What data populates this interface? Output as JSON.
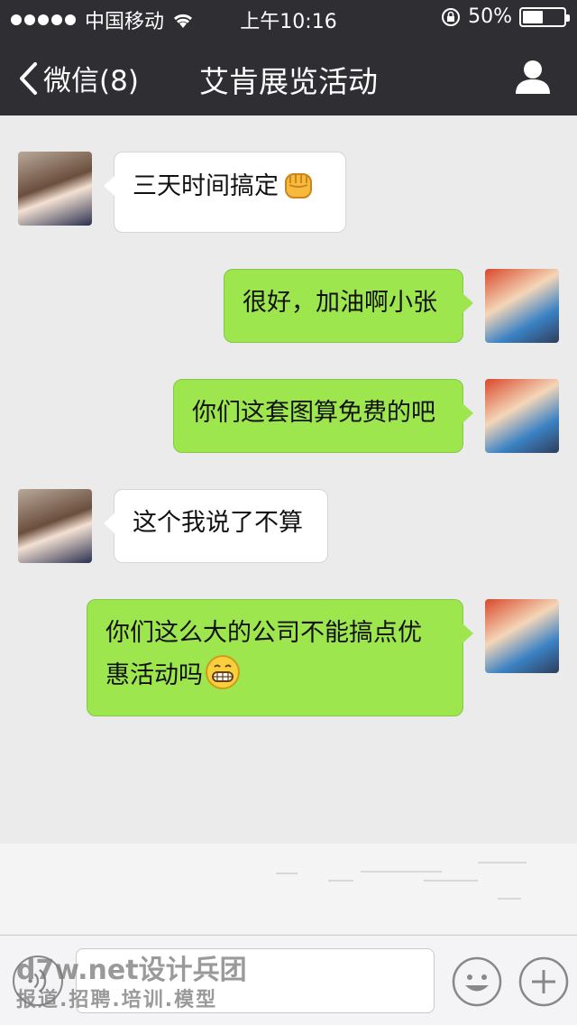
{
  "status_bar": {
    "carrier": "中国移动",
    "time": "上午10:16",
    "battery_text": "50%",
    "battery_level": 0.5
  },
  "nav": {
    "back_label": "微信(8)",
    "title": "艾肯展览活动",
    "user_icon": "user-icon"
  },
  "messages": [
    {
      "side": "in",
      "text": "三天时间搞定",
      "emoji": "fist-emoji"
    },
    {
      "side": "out",
      "text": "很好，加油啊小张"
    },
    {
      "side": "out",
      "text": "你们这套图算免费的吧"
    },
    {
      "side": "in",
      "text": "这个我说了不算"
    },
    {
      "side": "out",
      "text": "你们这么大的公司不能搞点优惠活动吗",
      "emoji": "grin-emoji"
    }
  ],
  "input_bar": {
    "voice_icon": "voice-icon",
    "emoji_icon": "smile-icon",
    "plus_icon": "plus-icon"
  },
  "watermark": {
    "line1": "d7w.net设计兵团",
    "line2": "报道.招聘.培训.模型"
  },
  "colors": {
    "bar_bg": "#2e2e33",
    "chat_bg": "#ebebeb",
    "out_bubble": "#9ee64e",
    "in_bubble": "#ffffff"
  }
}
